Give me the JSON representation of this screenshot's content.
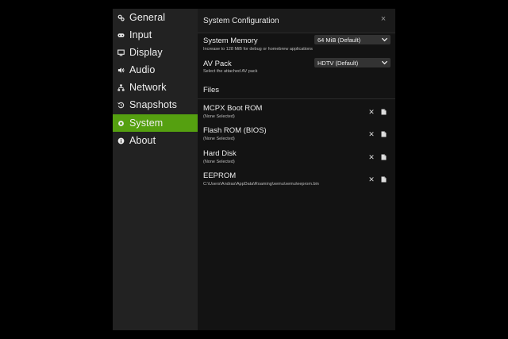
{
  "sidebar": {
    "items": [
      {
        "label": "General",
        "icon": "gears-icon",
        "active": false
      },
      {
        "label": "Input",
        "icon": "gamepad-icon",
        "active": false
      },
      {
        "label": "Display",
        "icon": "monitor-icon",
        "active": false
      },
      {
        "label": "Audio",
        "icon": "speaker-icon",
        "active": false
      },
      {
        "label": "Network",
        "icon": "network-icon",
        "active": false
      },
      {
        "label": "Snapshots",
        "icon": "history-icon",
        "active": false
      },
      {
        "label": "System",
        "icon": "chip-icon",
        "active": true
      },
      {
        "label": "About",
        "icon": "info-icon",
        "active": false
      }
    ],
    "active_color": "#55a010"
  },
  "header": {
    "title": "System Configuration",
    "close": "×"
  },
  "settings": {
    "memory": {
      "label": "System Memory",
      "hint": "Increase to 128 MiB for debug or homebrew applications",
      "value": "64 MiB (Default)"
    },
    "avpack": {
      "label": "AV Pack",
      "hint": "Select the attached AV pack",
      "value": "HDTV (Default)"
    }
  },
  "files": {
    "title": "Files",
    "items": [
      {
        "name": "MCPX Boot ROM",
        "path": "(None Selected)"
      },
      {
        "name": "Flash ROM (BIOS)",
        "path": "(None Selected)"
      },
      {
        "name": "Hard Disk",
        "path": "(None Selected)"
      },
      {
        "name": "EEPROM",
        "path": "C:\\Users\\Andras\\AppData\\Roaming\\xemu\\xemu\\eeprom.bin"
      }
    ],
    "clear_glyph": "✕"
  }
}
